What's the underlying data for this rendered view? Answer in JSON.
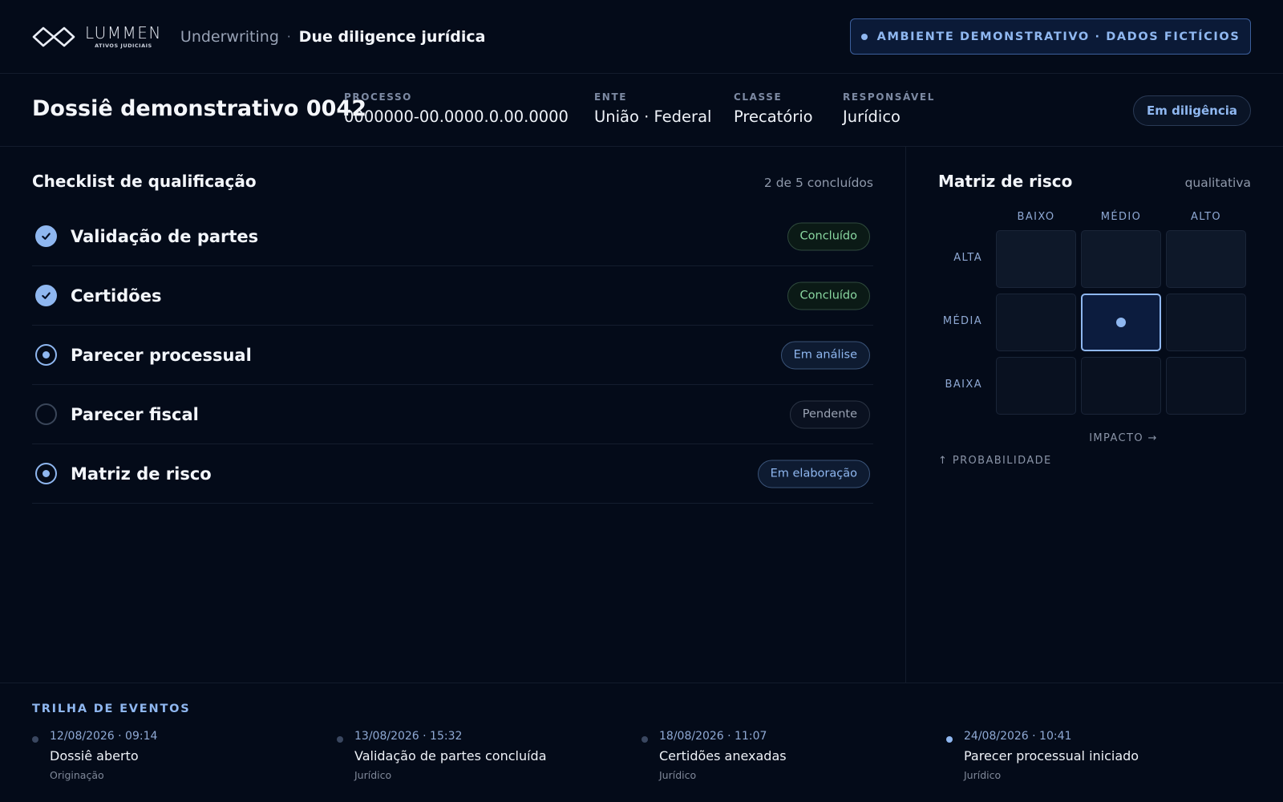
{
  "brand": {
    "name": "LUMMEN",
    "tagline": "ATIVOS JUDICIAIS"
  },
  "breadcrumb": {
    "section": "Underwriting",
    "separator": "·",
    "page": "Due diligence jurídica"
  },
  "env_banner": "AMBIENTE DEMONSTRATIVO · DADOS FICTÍCIOS",
  "dossier": {
    "title": "Dossiê demonstrativo 0042",
    "meta": [
      {
        "label": "PROCESSO",
        "value": "0000000-00.0000.0.00.0000"
      },
      {
        "label": "ENTE",
        "value": "União · Federal"
      },
      {
        "label": "CLASSE",
        "value": "Precatório"
      },
      {
        "label": "RESPONSÁVEL",
        "value": "Jurídico"
      }
    ],
    "status": "Em diligência"
  },
  "checklist": {
    "title": "Checklist de qualificação",
    "count": "2 de 5 concluídos",
    "items": [
      {
        "label": "Validação de partes",
        "state": "done",
        "badge": "Concluído"
      },
      {
        "label": "Certidões",
        "state": "done",
        "badge": "Concluído"
      },
      {
        "label": "Parecer processual",
        "state": "active",
        "badge": "Em análise"
      },
      {
        "label": "Parecer fiscal",
        "state": "pending",
        "badge": "Pendente"
      },
      {
        "label": "Matriz de risco",
        "state": "active",
        "badge": "Em elaboração"
      }
    ]
  },
  "risk_matrix": {
    "title": "Matriz de risco",
    "subtitle": "qualitativa",
    "impact_levels": [
      "BAIXO",
      "MÉDIO",
      "ALTO"
    ],
    "probability_levels": [
      "ALTA",
      "MÉDIA",
      "BAIXA"
    ],
    "selected": {
      "probability": "MÉDIA",
      "impact": "MÉDIO"
    },
    "x_axis": "IMPACTO →",
    "y_axis": "↑ PROBABILIDADE",
    "colors": {
      "accent": "#8fb7f0"
    }
  },
  "trail": {
    "title": "TRILHA DE EVENTOS",
    "events": [
      {
        "time": "12/08/2026 · 09:14",
        "name": "Dossiê aberto",
        "who": "Originação"
      },
      {
        "time": "13/08/2026 · 15:32",
        "name": "Validação de partes concluída",
        "who": "Jurídico"
      },
      {
        "time": "18/08/2026 · 11:07",
        "name": "Certidões anexadas",
        "who": "Jurídico"
      },
      {
        "time": "24/08/2026 · 10:41",
        "name": "Parecer processual iniciado",
        "who": "Jurídico"
      }
    ]
  }
}
